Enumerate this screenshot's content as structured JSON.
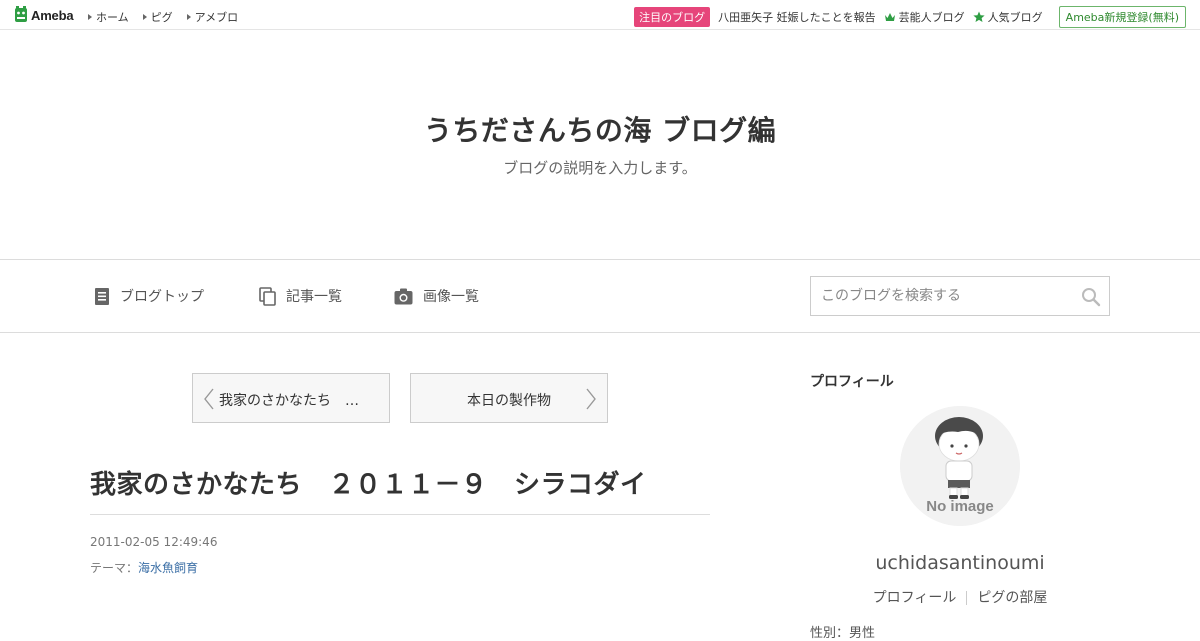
{
  "topbar": {
    "logo_text": "Ameba",
    "nav": [
      "ホーム",
      "ピグ",
      "アメブロ"
    ],
    "hot_badge": "注目のブログ",
    "hot_link": "八田亜矢子 妊娠したことを報告",
    "celeb_link": "芸能人ブログ",
    "popular_link": "人気ブログ",
    "register": "Ameba新規登録(無料)"
  },
  "header": {
    "title": "うちださんちの海 ブログ編",
    "description": "ブログの説明を入力します。"
  },
  "blog_nav": {
    "top": "ブログトップ",
    "list": "記事一覧",
    "images": "画像一覧",
    "search_placeholder": "このブログを検索する"
  },
  "pager": {
    "prev": "我家のさかなたち　…",
    "next": "本日の製作物"
  },
  "entry": {
    "title": "我家のさかなたち　２０１１－９　シラコダイ",
    "date": "2011-02-05 12:49:46",
    "theme_label": "テーマ：",
    "theme_value": "海水魚飼育"
  },
  "sidebar": {
    "heading": "プロフィール",
    "avatar_text": "No image",
    "username": "uchidasantinoumi",
    "profile_link": "プロフィール",
    "pig_link": "ピグの部屋",
    "cut_text": "性別：男性"
  },
  "colors": {
    "hot_badge": "#e6457a",
    "logo_green": "#2f9e44",
    "theme_link": "#3a6ea5"
  }
}
